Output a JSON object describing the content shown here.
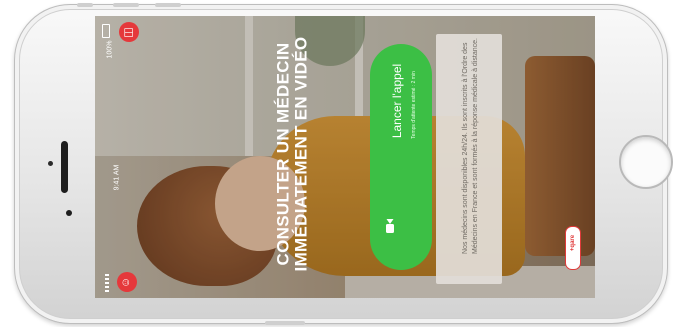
{
  "status_bar": {
    "time": "9:41 AM",
    "battery": "100%"
  },
  "hero": {
    "headline_line1": "CONSULTER UN MÉDECIN",
    "headline_line2": "IMMÉDIATEMENT EN VIDÉO"
  },
  "call": {
    "button_label": "Lancer l'appel",
    "wait_time": "Temps d'attente estimé : 2 min"
  },
  "info": {
    "text": "Nos médecins sont disponibles 24h/24. Ils sont inscrits à l'Ordre des Médecins en France et sont formés à la réponse médicale à distance."
  },
  "brand": {
    "logo_text": "+qare"
  },
  "icons": {
    "top_badge": "medical-bag-icon",
    "bottom_badge": "doctor-icon",
    "call_icon": "video-camera-icon"
  },
  "colors": {
    "accent_green": "#3cbf45",
    "brand_red": "#e5383b"
  }
}
